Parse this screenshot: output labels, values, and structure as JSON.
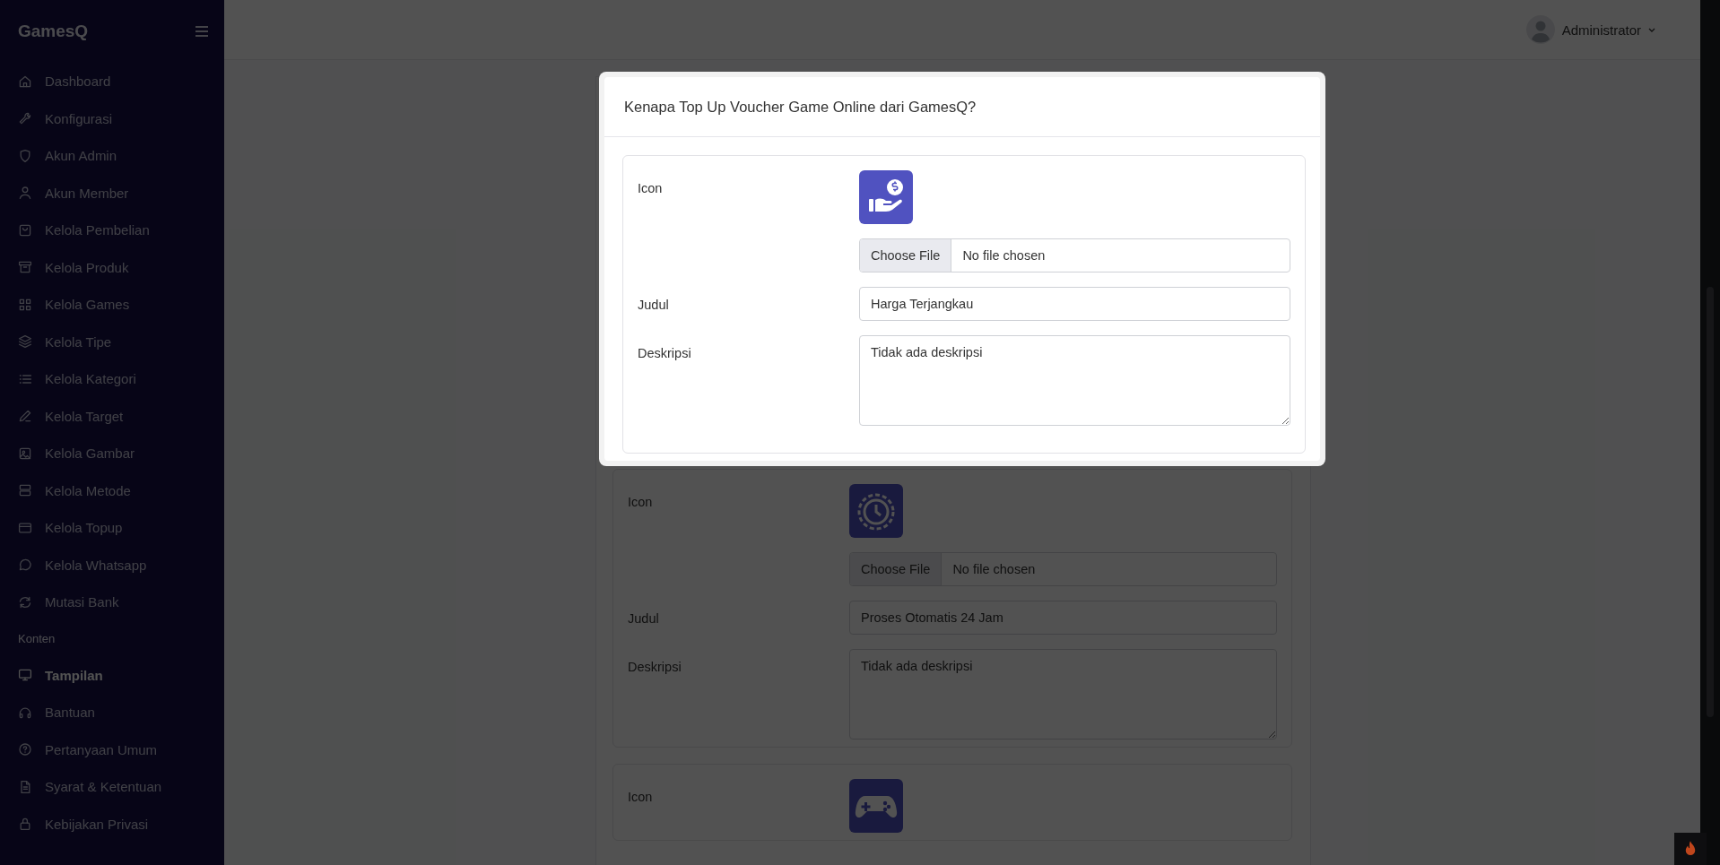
{
  "sidebar": {
    "brand": "GamesQ",
    "groups": [
      {
        "items": [
          {
            "label": "Dashboard",
            "selected": false
          },
          {
            "label": "Konfigurasi",
            "selected": false
          },
          {
            "label": "Akun Admin",
            "selected": false
          },
          {
            "label": "Akun Member",
            "selected": false
          },
          {
            "label": "Kelola Pembelian",
            "selected": false
          },
          {
            "label": "Kelola Produk",
            "selected": false
          },
          {
            "label": "Kelola Games",
            "selected": false
          },
          {
            "label": "Kelola Tipe",
            "selected": false
          },
          {
            "label": "Kelola Kategori",
            "selected": false
          },
          {
            "label": "Kelola Target",
            "selected": false
          },
          {
            "label": "Kelola Gambar",
            "selected": false
          },
          {
            "label": "Kelola Metode",
            "selected": false
          },
          {
            "label": "Kelola Topup",
            "selected": false
          },
          {
            "label": "Kelola Whatsapp",
            "selected": false
          },
          {
            "label": "Mutasi Bank",
            "selected": false
          }
        ]
      },
      {
        "title": "Konten",
        "items": [
          {
            "label": "Tampilan",
            "selected": true
          },
          {
            "label": "Bantuan",
            "selected": false
          },
          {
            "label": "Pertanyaan Umum",
            "selected": false
          },
          {
            "label": "Syarat & Ketentuan",
            "selected": false
          },
          {
            "label": "Kebijakan Privasi",
            "selected": false
          }
        ]
      }
    ]
  },
  "header": {
    "user": "Administrator"
  },
  "background_cards": [
    {
      "icon_label": "Icon",
      "file_button": "Choose File",
      "file_status": "No file chosen",
      "title_label": "Judul",
      "title_value": "Proses Otomatis 24 Jam",
      "description_label": "Deskripsi",
      "description_value": "Tidak ada deskripsi"
    },
    {
      "icon_label": "Icon"
    }
  ],
  "modal": {
    "title": "Kenapa Top Up Voucher Game Online dari GamesQ?",
    "card": {
      "icon_label": "Icon",
      "file_button": "Choose File",
      "file_status": "No file chosen",
      "title_label": "Judul",
      "title_value": "Harga Terjangkau",
      "description_label": "Deskripsi",
      "description_value": "Tidak ada deskripsi"
    }
  }
}
